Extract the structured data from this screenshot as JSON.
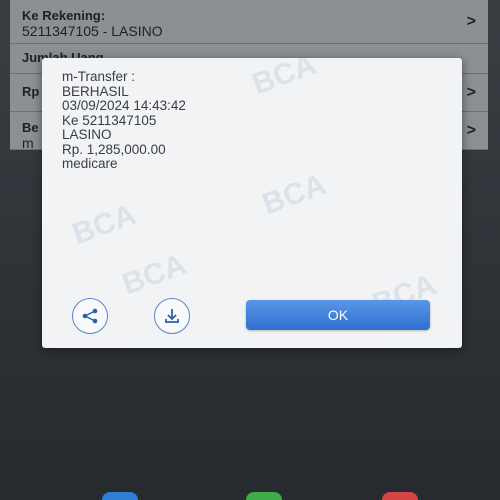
{
  "background_list": {
    "row1": {
      "label": "Ke Rekening:",
      "value": "5211347105 - LASINO"
    },
    "row2": {
      "label": "Jumlah Uang"
    },
    "row3": {
      "label": "Rp"
    },
    "row4": {
      "label": "Be",
      "value": "m"
    }
  },
  "dialog": {
    "title": "m-Transfer :",
    "status": "BERHASIL",
    "datetime": "03/09/2024 14:43:42",
    "destination": "Ke 5211347105",
    "recipient": "LASINO",
    "amount": "Rp. 1,285,000.00",
    "note": "medicare",
    "ok_label": "OK",
    "watermark": "BCA"
  },
  "icons": {
    "share": "share-icon",
    "download": "download-icon",
    "chevron": "chevron-right-icon"
  },
  "colors": {
    "accent": "#2f6fcf",
    "dialog_bg": "#f1f3f4",
    "icon_border": "#5b86c8"
  }
}
